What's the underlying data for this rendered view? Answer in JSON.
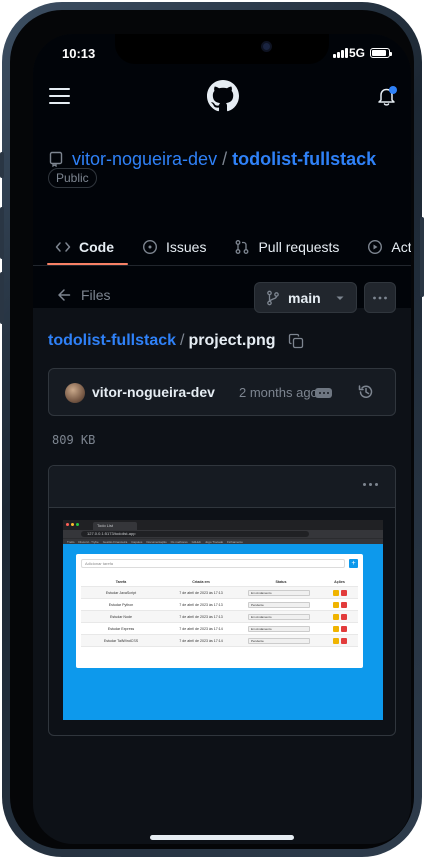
{
  "status_bar": {
    "time": "10:13",
    "network": "5G"
  },
  "colors": {
    "accent": "#2f81f7",
    "tab_underline": "#f78166",
    "notification_dot": "#2f81f7",
    "screen_bg": "#0d1117"
  },
  "header": {
    "menu_icon": "hamburger-icon",
    "logo_icon": "github-logo",
    "notification_icon": "bell-icon"
  },
  "repo": {
    "owner": "vitor-nogueira-dev",
    "separator": "/",
    "name": "todolist-fullstack",
    "visibility": "Public"
  },
  "tabs": [
    {
      "label": "Code",
      "icon": "code-icon"
    },
    {
      "label": "Issues",
      "icon": "issue-icon"
    },
    {
      "label": "Pull requests",
      "icon": "pull-request-icon"
    },
    {
      "label": "Actions",
      "icon": "play-icon"
    }
  ],
  "file_nav": {
    "back_label": "Files",
    "branch": "main"
  },
  "breadcrumb": {
    "repo": "todolist-fullstack",
    "separator": "/",
    "file": "project.png"
  },
  "commit": {
    "author": "vitor-nogueira-dev",
    "time_ago": "2 months ago"
  },
  "file_size": "809 KB",
  "preview": {
    "tab_title": "Todo List",
    "url": "127.0.0.1:5173/todolist-app",
    "bookmarks": [
      "Trello",
      "Discord - Trybe",
      "Gestão Financeira",
      "Caputos",
      "Documentação",
      "Os melhores",
      "GitHub",
      "Jogo Trocado",
      "Fichamento"
    ],
    "input_placeholder": "Adicionar tarefa",
    "add_label": "+",
    "columns": [
      "Tarefa",
      "Criada em",
      "Status",
      "Ações"
    ],
    "rows": [
      {
        "task": "Estudar JavaScript",
        "created": "7 de abril de 2023 às 17:13",
        "status": "Em Andamento"
      },
      {
        "task": "Estudar Python",
        "created": "7 de abril de 2023 às 17:13",
        "status": "Pendente"
      },
      {
        "task": "Estudar Node",
        "created": "7 de abril de 2023 às 17:13",
        "status": "Em Andamento"
      },
      {
        "task": "Estudar Express",
        "created": "7 de abril de 2023 às 17:14",
        "status": "Em Andamento"
      },
      {
        "task": "Estudar TailWindCSS",
        "created": "7 de abril de 2023 às 17:14",
        "status": "Pendente"
      }
    ]
  }
}
